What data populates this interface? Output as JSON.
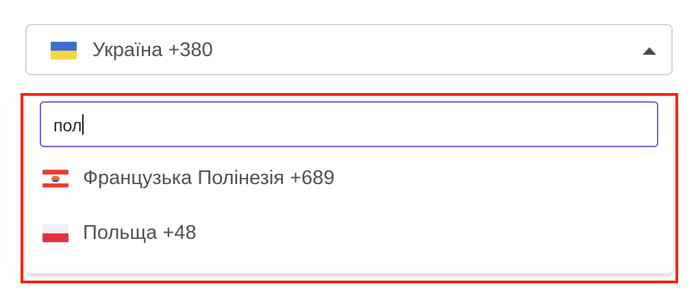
{
  "country_select": {
    "selected_label": "Україна +380",
    "selected_flag_icon": "ukraine-flag-icon",
    "expanded": true
  },
  "dropdown": {
    "search": {
      "value": "пол",
      "accent_color": "#7a56d8"
    },
    "options": [
      {
        "label": "Французька Полінезія +689",
        "flag_icon": "french-polynesia-flag-icon"
      },
      {
        "label": "Польща +48",
        "flag_icon": "poland-flag-icon"
      }
    ]
  },
  "highlight": {
    "color": "#f4220f"
  }
}
